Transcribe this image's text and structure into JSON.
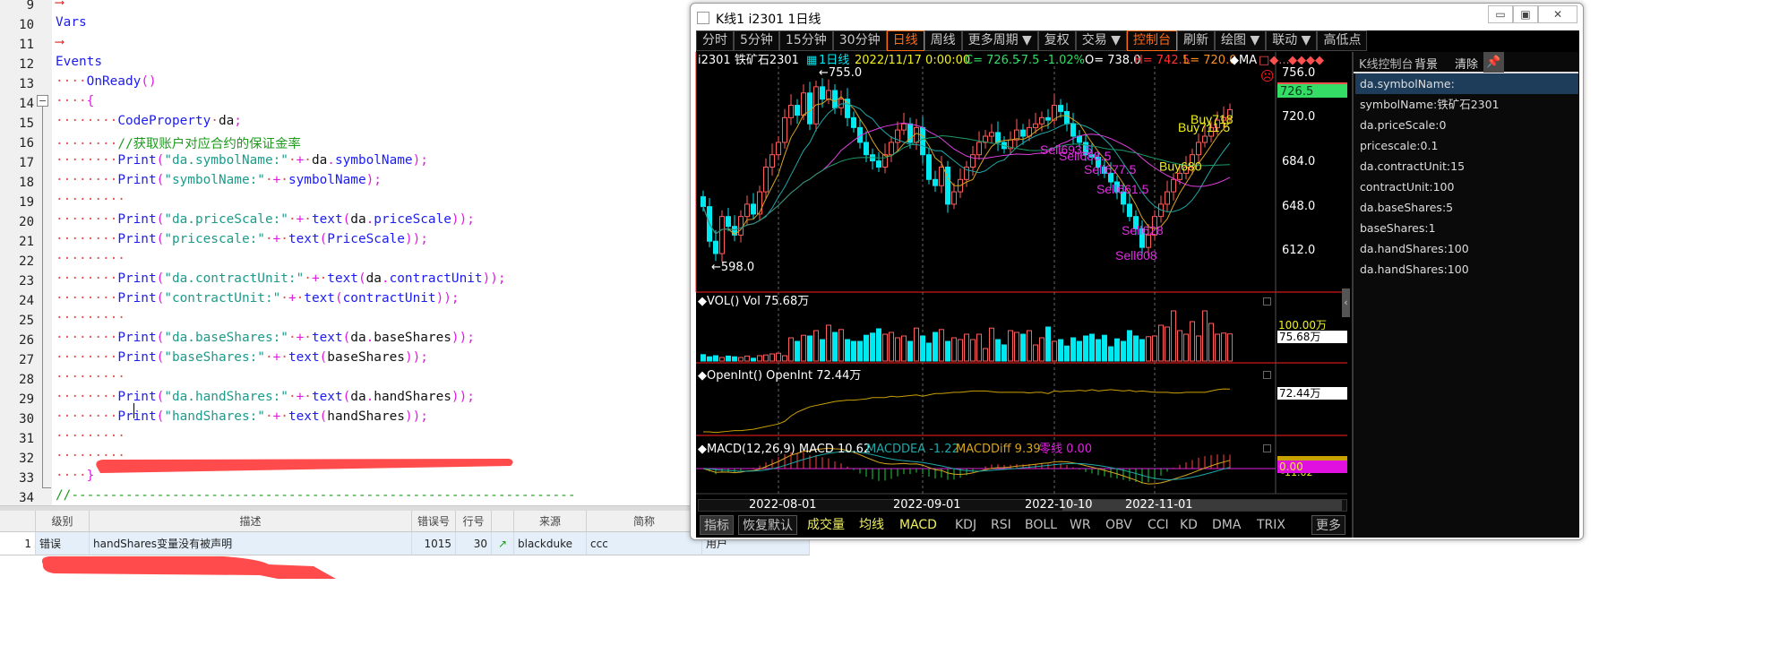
{
  "editor": {
    "lines": [
      {
        "n": "9",
        "t": [
          [
            "a",
            "⟶"
          ]
        ]
      },
      {
        "n": "10",
        "t": [
          [
            "k",
            "Vars"
          ]
        ]
      },
      {
        "n": "11",
        "t": [
          [
            "a",
            "⟶"
          ]
        ]
      },
      {
        "n": "12",
        "t": [
          [
            "k",
            "Events"
          ]
        ]
      },
      {
        "n": "13",
        "t": [
          [
            "w",
            "····"
          ],
          [
            "k",
            "OnReady"
          ],
          [
            "p",
            "()"
          ]
        ]
      },
      {
        "n": "14",
        "t": [
          [
            "w",
            "····"
          ],
          [
            "p",
            "{"
          ]
        ]
      },
      {
        "n": "15",
        "t": [
          [
            "w",
            "········"
          ],
          [
            "k",
            "CodeProperty"
          ],
          [
            "w",
            "·"
          ],
          [
            "i",
            "da"
          ],
          [
            "p",
            ";"
          ]
        ]
      },
      {
        "n": "16",
        "t": [
          [
            "w",
            "········"
          ],
          [
            "c",
            "//获取账户对应合约的保证金率"
          ]
        ]
      },
      {
        "n": "17",
        "t": [
          [
            "w",
            "········"
          ],
          [
            "k",
            "Print"
          ],
          [
            "p",
            "("
          ],
          [
            "s",
            "\"da.symbolName:\""
          ],
          [
            "w",
            "·"
          ],
          [
            "p",
            "+"
          ],
          [
            "w",
            "·"
          ],
          [
            "i",
            "da"
          ],
          [
            "p",
            "."
          ],
          [
            "m",
            "symbolName"
          ],
          [
            "p",
            ");"
          ]
        ]
      },
      {
        "n": "18",
        "t": [
          [
            "w",
            "········"
          ],
          [
            "k",
            "Print"
          ],
          [
            "p",
            "("
          ],
          [
            "s",
            "\"symbolName:\""
          ],
          [
            "w",
            "·"
          ],
          [
            "p",
            "+"
          ],
          [
            "w",
            "·"
          ],
          [
            "m",
            "symbolName"
          ],
          [
            "p",
            ");"
          ]
        ]
      },
      {
        "n": "19",
        "t": [
          [
            "w",
            "·········"
          ]
        ]
      },
      {
        "n": "20",
        "t": [
          [
            "w",
            "········"
          ],
          [
            "k",
            "Print"
          ],
          [
            "p",
            "("
          ],
          [
            "s",
            "\"da.priceScale:\""
          ],
          [
            "w",
            "·"
          ],
          [
            "p",
            "+"
          ],
          [
            "w",
            "·"
          ],
          [
            "k",
            "text"
          ],
          [
            "p",
            "("
          ],
          [
            "i",
            "da"
          ],
          [
            "p",
            "."
          ],
          [
            "m",
            "priceScale"
          ],
          [
            "p",
            "));"
          ]
        ]
      },
      {
        "n": "21",
        "t": [
          [
            "w",
            "········"
          ],
          [
            "k",
            "Print"
          ],
          [
            "p",
            "("
          ],
          [
            "s",
            "\"pricescale:\""
          ],
          [
            "w",
            "·"
          ],
          [
            "p",
            "+"
          ],
          [
            "w",
            "·"
          ],
          [
            "k",
            "text"
          ],
          [
            "p",
            "("
          ],
          [
            "m",
            "PriceScale"
          ],
          [
            "p",
            "));"
          ]
        ]
      },
      {
        "n": "22",
        "t": [
          [
            "w",
            "·········"
          ]
        ]
      },
      {
        "n": "23",
        "t": [
          [
            "w",
            "········"
          ],
          [
            "k",
            "Print"
          ],
          [
            "p",
            "("
          ],
          [
            "s",
            "\"da.contractUnit:\""
          ],
          [
            "w",
            "·"
          ],
          [
            "p",
            "+"
          ],
          [
            "w",
            "·"
          ],
          [
            "k",
            "text"
          ],
          [
            "p",
            "("
          ],
          [
            "i",
            "da"
          ],
          [
            "p",
            "."
          ],
          [
            "m",
            "contractUnit"
          ],
          [
            "p",
            "));"
          ]
        ]
      },
      {
        "n": "24",
        "t": [
          [
            "w",
            "········"
          ],
          [
            "k",
            "Print"
          ],
          [
            "p",
            "("
          ],
          [
            "s",
            "\"contractUnit:\""
          ],
          [
            "w",
            "·"
          ],
          [
            "p",
            "+"
          ],
          [
            "w",
            "·"
          ],
          [
            "k",
            "text"
          ],
          [
            "p",
            "("
          ],
          [
            "m",
            "contractUnit"
          ],
          [
            "p",
            "));"
          ]
        ]
      },
      {
        "n": "25",
        "t": [
          [
            "w",
            "·········"
          ]
        ]
      },
      {
        "n": "26",
        "t": [
          [
            "w",
            "········"
          ],
          [
            "k",
            "Print"
          ],
          [
            "p",
            "("
          ],
          [
            "s",
            "\"da.baseShares:\""
          ],
          [
            "w",
            "·"
          ],
          [
            "p",
            "+"
          ],
          [
            "w",
            "·"
          ],
          [
            "k",
            "text"
          ],
          [
            "p",
            "("
          ],
          [
            "i",
            "da"
          ],
          [
            "p",
            "."
          ],
          [
            "i",
            "baseShares"
          ],
          [
            "p",
            "));"
          ]
        ]
      },
      {
        "n": "27",
        "t": [
          [
            "w",
            "········"
          ],
          [
            "k",
            "Print"
          ],
          [
            "p",
            "("
          ],
          [
            "s",
            "\"baseShares:\""
          ],
          [
            "w",
            "·"
          ],
          [
            "p",
            "+"
          ],
          [
            "w",
            "·"
          ],
          [
            "k",
            "text"
          ],
          [
            "p",
            "("
          ],
          [
            "i",
            "baseShares"
          ],
          [
            "p",
            "));"
          ]
        ]
      },
      {
        "n": "28",
        "t": [
          [
            "w",
            "·········"
          ]
        ]
      },
      {
        "n": "29",
        "t": [
          [
            "w",
            "········"
          ],
          [
            "k",
            "Print"
          ],
          [
            "p",
            "("
          ],
          [
            "s",
            "\"da.handShares:\""
          ],
          [
            "w",
            "·"
          ],
          [
            "p",
            "+"
          ],
          [
            "w",
            "·"
          ],
          [
            "k",
            "text"
          ],
          [
            "p",
            "("
          ],
          [
            "i",
            "da"
          ],
          [
            "p",
            "."
          ],
          [
            "i",
            "handShares"
          ],
          [
            "p",
            "));"
          ]
        ]
      },
      {
        "n": "30",
        "t": [
          [
            "w",
            "········"
          ],
          [
            "k",
            "Print"
          ],
          [
            "p",
            "("
          ],
          [
            "s",
            "\"handShares:\""
          ],
          [
            "w",
            "·"
          ],
          [
            "p",
            "+"
          ],
          [
            "w",
            "·"
          ],
          [
            "k",
            "text"
          ],
          [
            "p",
            "("
          ],
          [
            "i",
            "handShares"
          ],
          [
            "p",
            "));"
          ]
        ]
      },
      {
        "n": "31",
        "t": [
          [
            "w",
            "·········"
          ]
        ]
      },
      {
        "n": "32",
        "t": [
          [
            "w",
            "·········"
          ]
        ]
      },
      {
        "n": "33",
        "t": [
          [
            "w",
            "····"
          ],
          [
            "p",
            "}"
          ]
        ]
      },
      {
        "n": "34",
        "t": [
          [
            "c",
            "//-----------------------------------------------------------------"
          ]
        ]
      }
    ]
  },
  "errors": {
    "headers": [
      "",
      "级别",
      "描述",
      "错误号",
      "行号",
      "",
      "来源",
      "简称",
      "用户"
    ],
    "rows": [
      {
        "index": "1",
        "level": "错误",
        "description": "handShares变量没有被声明",
        "code": "1015",
        "line": "30",
        "source": "blackduke",
        "short": "ccc",
        "user": "用户"
      }
    ]
  },
  "window": {
    "title": "K线1 i2301 1日线",
    "controls": {
      "minimize": "▭",
      "maximize": "▣",
      "close": "✕"
    },
    "toolbar": [
      {
        "label": "分时"
      },
      {
        "label": "5分钟"
      },
      {
        "label": "15分钟"
      },
      {
        "label": "30分钟"
      },
      {
        "label": "日线",
        "active": true
      },
      {
        "label": "周线"
      },
      {
        "label": "更多周期 ▼"
      },
      {
        "label": "复权"
      },
      {
        "label": "交易 ▼"
      },
      {
        "label": "控制台",
        "active": true
      },
      {
        "label": "刷新"
      },
      {
        "label": "绘图 ▼"
      },
      {
        "label": "联动 ▼"
      },
      {
        "label": "高低点"
      }
    ],
    "quote": {
      "symbol": "i2301 铁矿石2301",
      "period": "1日线",
      "datetime": "2022/11/17 0:00:00",
      "close": "C= 726.5",
      "change": "-7.5",
      "change_pct": "-1.02%",
      "open": "O= 738.0",
      "high": "H= 742.5",
      "low": "L= 720.0",
      "ma": "◆MA",
      "more": "□◆...",
      "diamonds": "◆◆◆◆"
    },
    "colors": {
      "up": "#ff5c5c",
      "down": "#00e8f0",
      "ma5": "#d9a520",
      "ma10": "#1fa8a8",
      "ma20": "#e040e0",
      "ma30": "#1f9a6a",
      "current": "#33dd66"
    },
    "price_axis": [
      "756.0",
      "720.0",
      "684.0",
      "648.0",
      "612.0"
    ],
    "price_axis_values": [
      756,
      720,
      684,
      648,
      612
    ],
    "current_price": "726.5",
    "high_marker": "←755.0",
    "low_marker": "←598.0",
    "chart_data": {
      "type": "candlestick",
      "closes": [
        648,
        620,
        610,
        640,
        632,
        625,
        640,
        650,
        642,
        660,
        680,
        690,
        700,
        720,
        730,
        722,
        740,
        715,
        745,
        735,
        742,
        728,
        735,
        720,
        712,
        700,
        690,
        685,
        680,
        690,
        700,
        710,
        715,
        700,
        712,
        690,
        670,
        665,
        680,
        650,
        660,
        670,
        680,
        690,
        700,
        705,
        708,
        700,
        695,
        702,
        710,
        705,
        712,
        715,
        720,
        718,
        730,
        725,
        715,
        705,
        700,
        690,
        688,
        680,
        675,
        668,
        660,
        650,
        640,
        630,
        615,
        625,
        640,
        650,
        660,
        670,
        675,
        680,
        690,
        700,
        705,
        712,
        718,
        720,
        726.5
      ],
      "high_point": 755.0,
      "low_point": 598.0,
      "signals": [
        {
          "label": "Sell693.5",
          "index": 58,
          "price": 693.5,
          "side": "sell"
        },
        {
          "label": "Sell688.5",
          "index": 61,
          "price": 688.5,
          "side": "sell"
        },
        {
          "label": "Sell677.5",
          "index": 65,
          "price": 677.5,
          "side": "sell"
        },
        {
          "label": "Sell661.5",
          "index": 67,
          "price": 661.5,
          "side": "sell"
        },
        {
          "label": "Sell608",
          "index": 70,
          "price": 608,
          "side": "sell"
        },
        {
          "label": "Sell628",
          "index": 71,
          "price": 628,
          "side": "sell"
        },
        {
          "label": "Buy680",
          "index": 77,
          "price": 680,
          "side": "buy"
        },
        {
          "label": "Buy711.5",
          "index": 80,
          "price": 711.5,
          "side": "buy"
        },
        {
          "label": "Buy718",
          "index": 82,
          "price": 718,
          "side": "buy"
        }
      ],
      "volume": [
        18,
        12,
        15,
        10,
        14,
        12,
        10,
        14,
        8,
        15,
        17,
        20,
        22,
        15,
        65,
        55,
        72,
        70,
        85,
        60,
        100,
        80,
        88,
        60,
        55,
        55,
        72,
        78,
        90,
        75,
        80,
        65,
        70,
        55,
        92,
        70,
        50,
        80,
        88,
        55,
        65,
        60,
        75,
        60,
        75,
        35,
        92,
        60,
        45,
        85,
        80,
        75,
        85,
        45,
        65,
        95,
        55,
        60,
        42,
        65,
        55,
        70,
        75,
        60,
        72,
        40,
        62,
        55,
        85,
        70,
        60,
        68,
        70,
        100,
        95,
        140,
        85,
        75,
        110,
        70,
        140,
        105,
        75,
        78,
        75.68
      ],
      "open_interest": [
        40,
        40,
        39.5,
        40,
        40.5,
        41,
        41,
        41.5,
        42,
        43,
        44,
        45,
        46,
        48,
        52,
        55,
        57,
        59,
        60,
        61,
        62,
        63,
        63.5,
        64,
        64,
        64.5,
        65,
        66,
        66,
        66,
        67,
        66.5,
        67,
        67.5,
        68,
        67,
        68,
        69,
        69,
        69.5,
        70,
        70,
        70.5,
        71,
        71,
        71,
        70.5,
        70,
        70,
        70,
        70,
        70,
        69.5,
        70,
        70,
        69,
        71,
        70.5,
        71,
        71,
        71.5,
        71,
        72,
        71,
        71.5,
        72,
        71.5,
        71,
        71.5,
        70.5,
        71,
        70.5,
        70,
        70,
        70,
        69.5,
        69.5,
        70,
        70,
        70,
        70,
        71,
        72,
        72.5,
        72.44
      ],
      "x_ticks": [
        {
          "label": "2022-08-01",
          "index": 12
        },
        {
          "label": "2022-09-01",
          "index": 35
        },
        {
          "label": "2022-10-10",
          "index": 56
        },
        {
          "label": "2022-11-01",
          "index": 72
        }
      ]
    },
    "vol": {
      "title": "◆VOL() Vol 75.68万",
      "axis": "100.00万",
      "value": "75.68万"
    },
    "openint": {
      "title": "◆OpenInt() OpenInt 72.44万",
      "value": "72.44万"
    },
    "macd": {
      "title": "◆MACD(12,26,9) MACD 10.62",
      "dea": "MACDDEA -1.22",
      "diff": "MACDDiff 9.39",
      "zero": "零线 0.00",
      "axis_zero": "0.00",
      "axis_low": "-11.02"
    },
    "bottom_tabs": [
      {
        "label": "指标",
        "active": true
      },
      {
        "label": "恢复默认"
      },
      {
        "label": "成交量",
        "hl": true
      },
      {
        "label": "均线",
        "hl": true
      },
      {
        "label": "MACD",
        "hl": true
      },
      {
        "label": "KDJ"
      },
      {
        "label": "RSI"
      },
      {
        "label": "BOLL"
      },
      {
        "label": "WR"
      },
      {
        "label": "OBV"
      },
      {
        "label": "CCI"
      },
      {
        "label": "KD"
      },
      {
        "label": "DMA"
      },
      {
        "label": "TRIX"
      },
      {
        "label": "更多"
      }
    ],
    "console": {
      "title": "K线控制台",
      "background": "背景",
      "clear": "清除",
      "pin_icon": "pushpin-icon",
      "lines": [
        "da.symbolName:",
        "symbolName:铁矿石2301",
        "da.priceScale:0",
        "pricescale:0.1",
        "da.contractUnit:15",
        "contractUnit:100",
        "da.baseShares:5",
        "baseShares:1",
        "da.handShares:100",
        "da.handShares:100"
      ]
    }
  }
}
